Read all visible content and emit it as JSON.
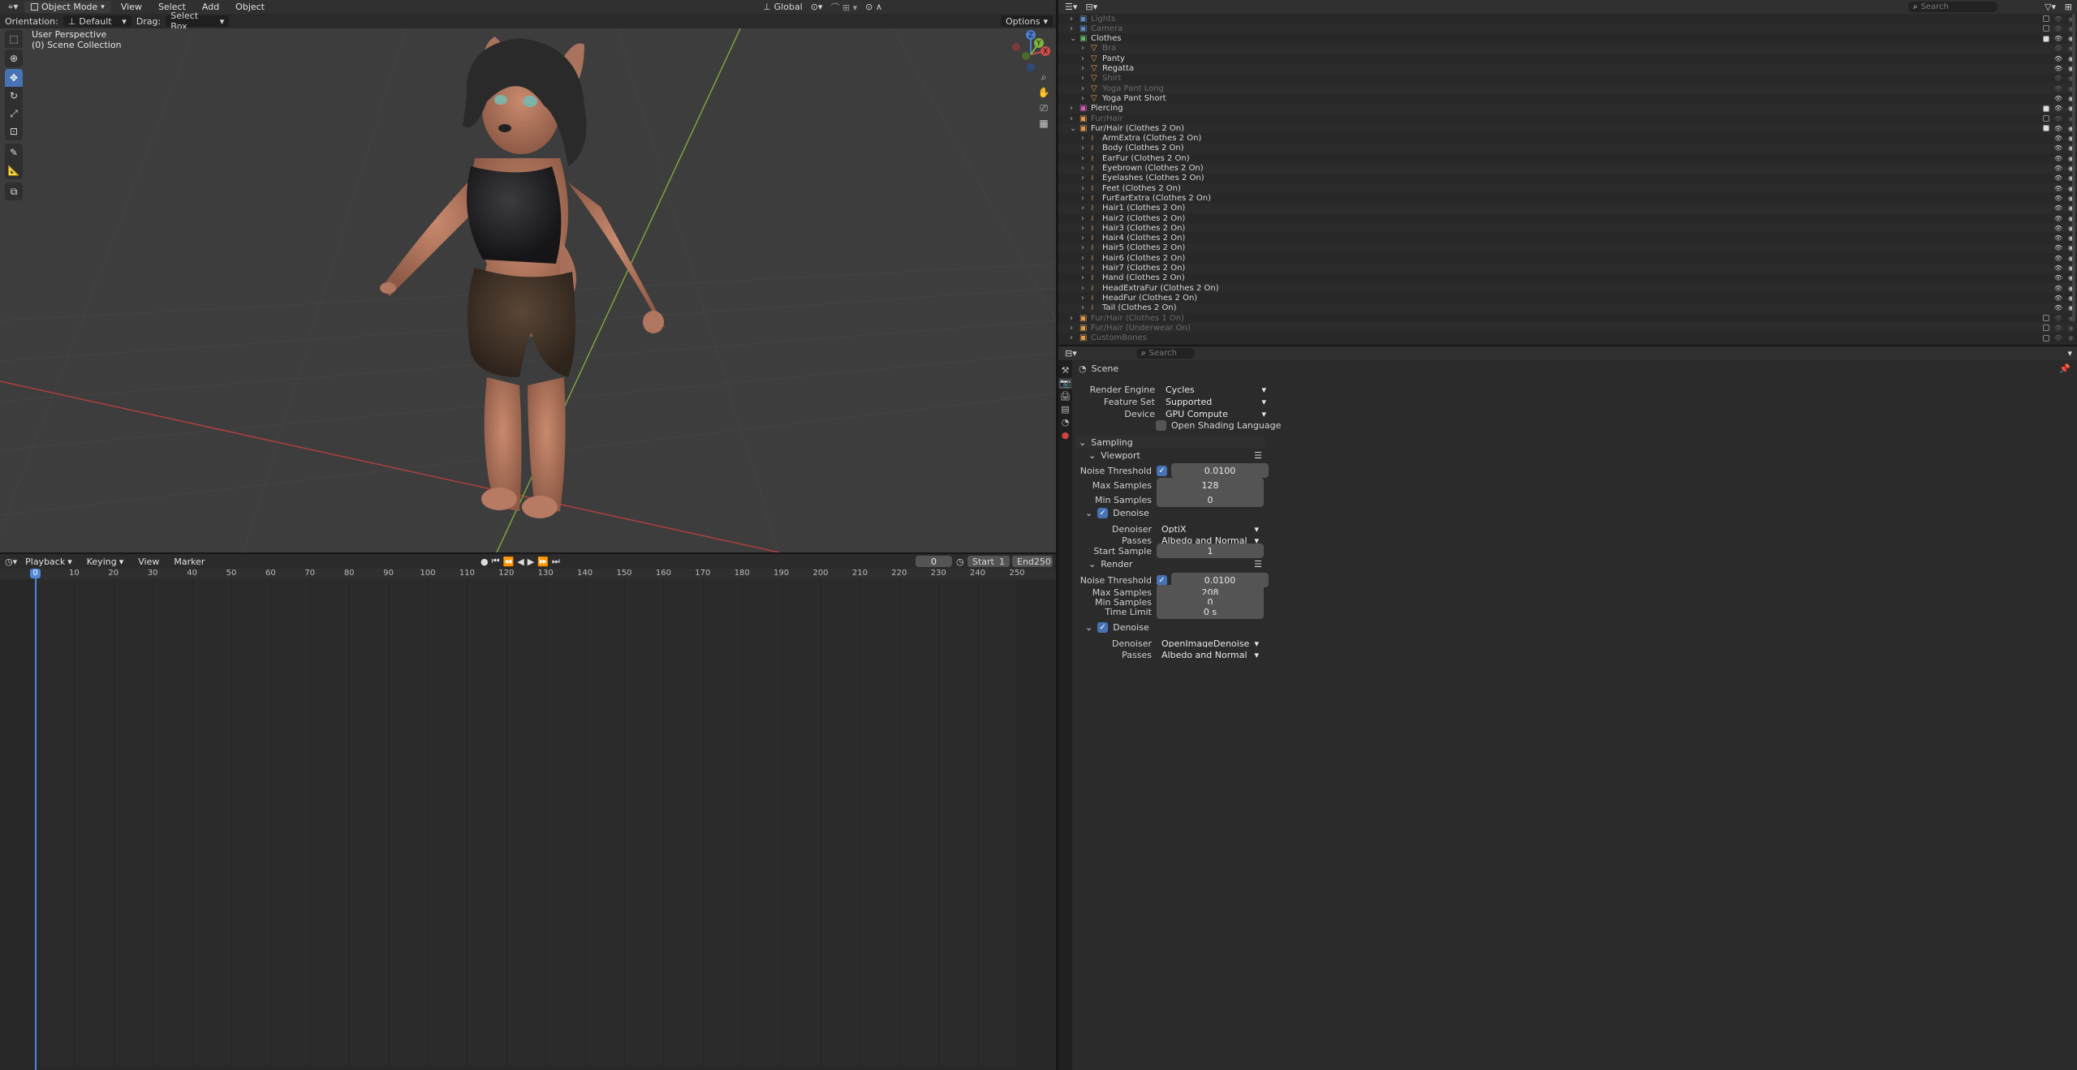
{
  "header": {
    "mode": "Object Mode",
    "menus": [
      "View",
      "Select",
      "Add",
      "Object"
    ],
    "transform_orientation": "Global",
    "search_placeholder": "Search",
    "orientation_label": "Orientation:",
    "orientation_value": "Default",
    "drag_label": "Drag:",
    "drag_value": "Select Box",
    "options_label": "Options"
  },
  "viewport": {
    "perspective": "User Perspective",
    "collection": "(0) Scene Collection",
    "gizmo": {
      "x": "X",
      "y": "Y",
      "z": "Z"
    }
  },
  "outliner": {
    "items": [
      {
        "name": "Lights",
        "indent": 1,
        "dim": true,
        "icon": "collection",
        "color": "#5a8ac4"
      },
      {
        "name": "Camera",
        "indent": 1,
        "dim": true,
        "icon": "collection",
        "color": "#5a8ac4"
      },
      {
        "name": "Clothes",
        "indent": 1,
        "dim": false,
        "icon": "collection",
        "color": "#68b168",
        "expanded": true
      },
      {
        "name": "Bra",
        "indent": 2,
        "dim": true,
        "icon": "mesh",
        "color": "#e09a4a"
      },
      {
        "name": "Panty",
        "indent": 2,
        "dim": false,
        "icon": "mesh",
        "color": "#e09a4a"
      },
      {
        "name": "Regatta",
        "indent": 2,
        "dim": false,
        "icon": "mesh",
        "color": "#e09a4a"
      },
      {
        "name": "Shirt",
        "indent": 2,
        "dim": true,
        "icon": "mesh",
        "color": "#e09a4a"
      },
      {
        "name": "Yoga Pant Long",
        "indent": 2,
        "dim": true,
        "icon": "mesh",
        "color": "#e09a4a"
      },
      {
        "name": "Yoga Pant Short",
        "indent": 2,
        "dim": false,
        "icon": "mesh",
        "color": "#e09a4a"
      },
      {
        "name": "Piercing",
        "indent": 1,
        "dim": false,
        "icon": "collection",
        "color": "#d15fb5"
      },
      {
        "name": "Fur/Hair",
        "indent": 1,
        "dim": true,
        "icon": "collection",
        "color": "#e09a4a"
      },
      {
        "name": "Fur/Hair (Clothes 2 On)",
        "indent": 1,
        "dim": false,
        "icon": "collection",
        "color": "#e09a4a",
        "expanded": true
      },
      {
        "name": "ArmExtra (Clothes 2 On)",
        "indent": 2,
        "dim": false,
        "icon": "hair",
        "color": "#e09a4a"
      },
      {
        "name": "Body (Clothes 2 On)",
        "indent": 2,
        "dim": false,
        "icon": "hair",
        "color": "#e09a4a"
      },
      {
        "name": "EarFur (Clothes 2 On)",
        "indent": 2,
        "dim": false,
        "icon": "hair",
        "color": "#e09a4a"
      },
      {
        "name": "Eyebrown (Clothes 2 On)",
        "indent": 2,
        "dim": false,
        "icon": "hair",
        "color": "#e09a4a"
      },
      {
        "name": "Eyelashes (Clothes 2 On)",
        "indent": 2,
        "dim": false,
        "icon": "hair",
        "color": "#e09a4a"
      },
      {
        "name": "Feet (Clothes 2 On)",
        "indent": 2,
        "dim": false,
        "icon": "hair",
        "color": "#e09a4a"
      },
      {
        "name": "FurEarExtra (Clothes 2 On)",
        "indent": 2,
        "dim": false,
        "icon": "hair",
        "color": "#e09a4a"
      },
      {
        "name": "Hair1 (Clothes 2 On)",
        "indent": 2,
        "dim": false,
        "icon": "hair",
        "color": "#e09a4a"
      },
      {
        "name": "Hair2 (Clothes 2 On)",
        "indent": 2,
        "dim": false,
        "icon": "hair",
        "color": "#e09a4a"
      },
      {
        "name": "Hair3 (Clothes 2 On)",
        "indent": 2,
        "dim": false,
        "icon": "hair",
        "color": "#e09a4a"
      },
      {
        "name": "Hair4 (Clothes 2 On)",
        "indent": 2,
        "dim": false,
        "icon": "hair",
        "color": "#e09a4a"
      },
      {
        "name": "Hair5 (Clothes 2 On)",
        "indent": 2,
        "dim": false,
        "icon": "hair",
        "color": "#e09a4a"
      },
      {
        "name": "Hair6 (Clothes 2 On)",
        "indent": 2,
        "dim": false,
        "icon": "hair",
        "color": "#e09a4a"
      },
      {
        "name": "Hair7 (Clothes 2 On)",
        "indent": 2,
        "dim": false,
        "icon": "hair",
        "color": "#e09a4a"
      },
      {
        "name": "Hand (Clothes 2 On)",
        "indent": 2,
        "dim": false,
        "icon": "hair",
        "color": "#e09a4a"
      },
      {
        "name": "HeadExtraFur (Clothes 2 On)",
        "indent": 2,
        "dim": false,
        "icon": "hair",
        "color": "#e09a4a"
      },
      {
        "name": "HeadFur (Clothes 2 On)",
        "indent": 2,
        "dim": false,
        "icon": "hair",
        "color": "#e09a4a"
      },
      {
        "name": "Tail (Clothes 2 On)",
        "indent": 2,
        "dim": false,
        "icon": "hair",
        "color": "#e09a4a"
      },
      {
        "name": "Fur/Hair (Clothes 1 On)",
        "indent": 1,
        "dim": true,
        "icon": "collection",
        "color": "#e09a4a"
      },
      {
        "name": "Fur/Hair (Underwear On)",
        "indent": 1,
        "dim": true,
        "icon": "collection",
        "color": "#e09a4a"
      },
      {
        "name": "CustomBones",
        "indent": 1,
        "dim": true,
        "icon": "collection",
        "color": "#e09a4a"
      }
    ]
  },
  "properties": {
    "search_placeholder": "Search",
    "context": "Scene",
    "render_engine_label": "Render Engine",
    "render_engine": "Cycles",
    "feature_set_label": "Feature Set",
    "feature_set": "Supported",
    "device_label": "Device",
    "device": "GPU Compute",
    "osl_label": "Open Shading Language",
    "sampling": "Sampling",
    "viewport": "Viewport",
    "noise_threshold_label": "Noise Threshold",
    "vp_noise": "0.0100",
    "max_samples_label": "Max Samples",
    "vp_max": "128",
    "min_samples_label": "Min Samples",
    "vp_min": "0",
    "denoise": "Denoise",
    "denoiser_label": "Denoiser",
    "vp_denoiser": "OptiX",
    "passes_label": "Passes",
    "vp_passes": "Albedo and Normal",
    "start_sample_label": "Start Sample",
    "vp_start": "1",
    "render": "Render",
    "r_noise": "0.0100",
    "r_max": "208",
    "r_min": "0",
    "time_limit_label": "Time Limit",
    "r_time": "0 s",
    "r_denoiser": "OpenImageDenoise",
    "r_passes": "Albedo and Normal"
  },
  "timeline": {
    "menus": [
      "Playback",
      "Keying",
      "View",
      "Marker"
    ],
    "current_frame": "0",
    "start_label": "Start",
    "start": "1",
    "end_label": "End",
    "end": "250",
    "ticks": [
      "0",
      "10",
      "20",
      "30",
      "40",
      "50",
      "60",
      "70",
      "80",
      "90",
      "100",
      "110",
      "120",
      "130",
      "140",
      "150",
      "160",
      "170",
      "180",
      "190",
      "200",
      "210",
      "220",
      "230",
      "240",
      "250"
    ]
  }
}
